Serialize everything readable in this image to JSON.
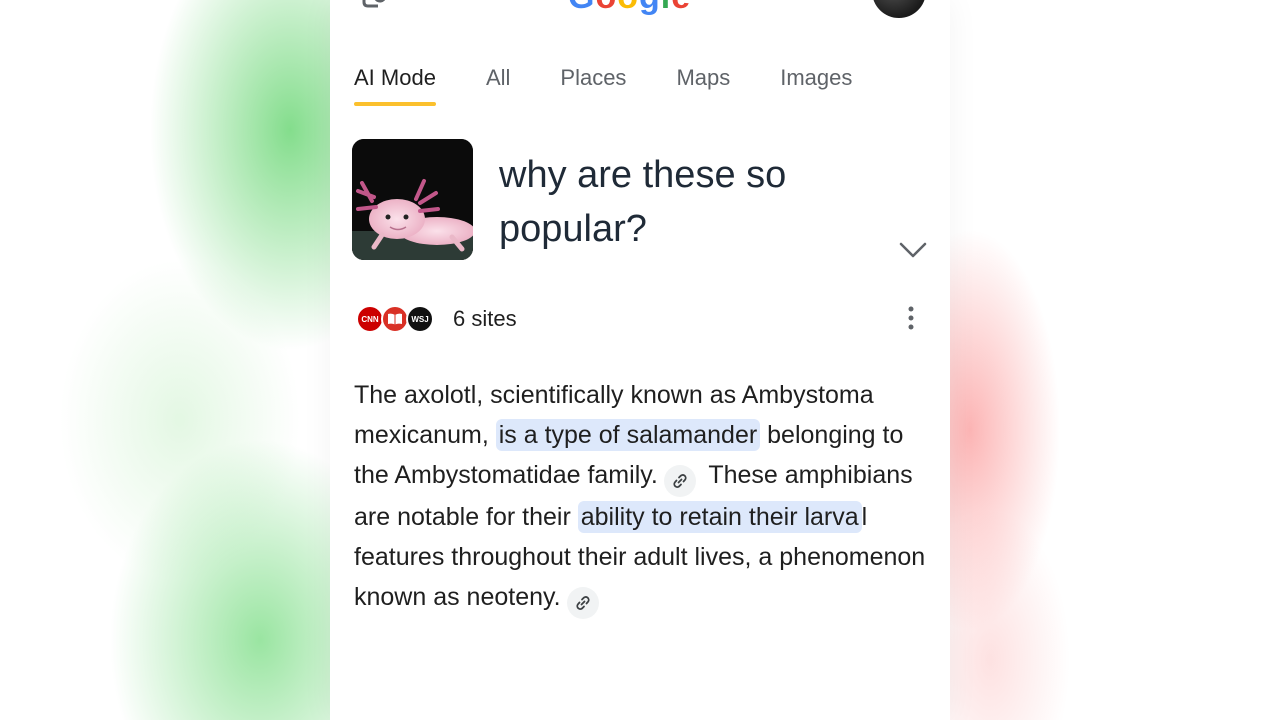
{
  "header": {
    "logo_letters": [
      "G",
      "o",
      "o",
      "g",
      "l",
      "e"
    ]
  },
  "tabs": [
    {
      "label": "AI Mode",
      "active": true
    },
    {
      "label": "All",
      "active": false
    },
    {
      "label": "Places",
      "active": false
    },
    {
      "label": "Maps",
      "active": false
    },
    {
      "label": "Images",
      "active": false
    }
  ],
  "query": {
    "text": "why are these so popular?",
    "image": "axolotl-thumbnail"
  },
  "sources": {
    "logos": [
      "CNN",
      "book-icon",
      "WSJ"
    ],
    "count_label": "6 sites"
  },
  "answer": {
    "s1": "The axolotl, scientifically known as Ambystoma mexicanum, ",
    "h1": "is a type of salamander",
    "s2": " belonging to the Ambystomatidae family.",
    "s3": " These amphibians are notable for their ",
    "h2": "ability to retain their larva",
    "s4": "l features throughout their adult lives, a phenomenon known as neoteny."
  },
  "colors": {
    "active_tab_underline": "#fbc02d",
    "highlight": "#dde8fb",
    "text": "#1f1f1f",
    "muted": "#5f6368"
  }
}
